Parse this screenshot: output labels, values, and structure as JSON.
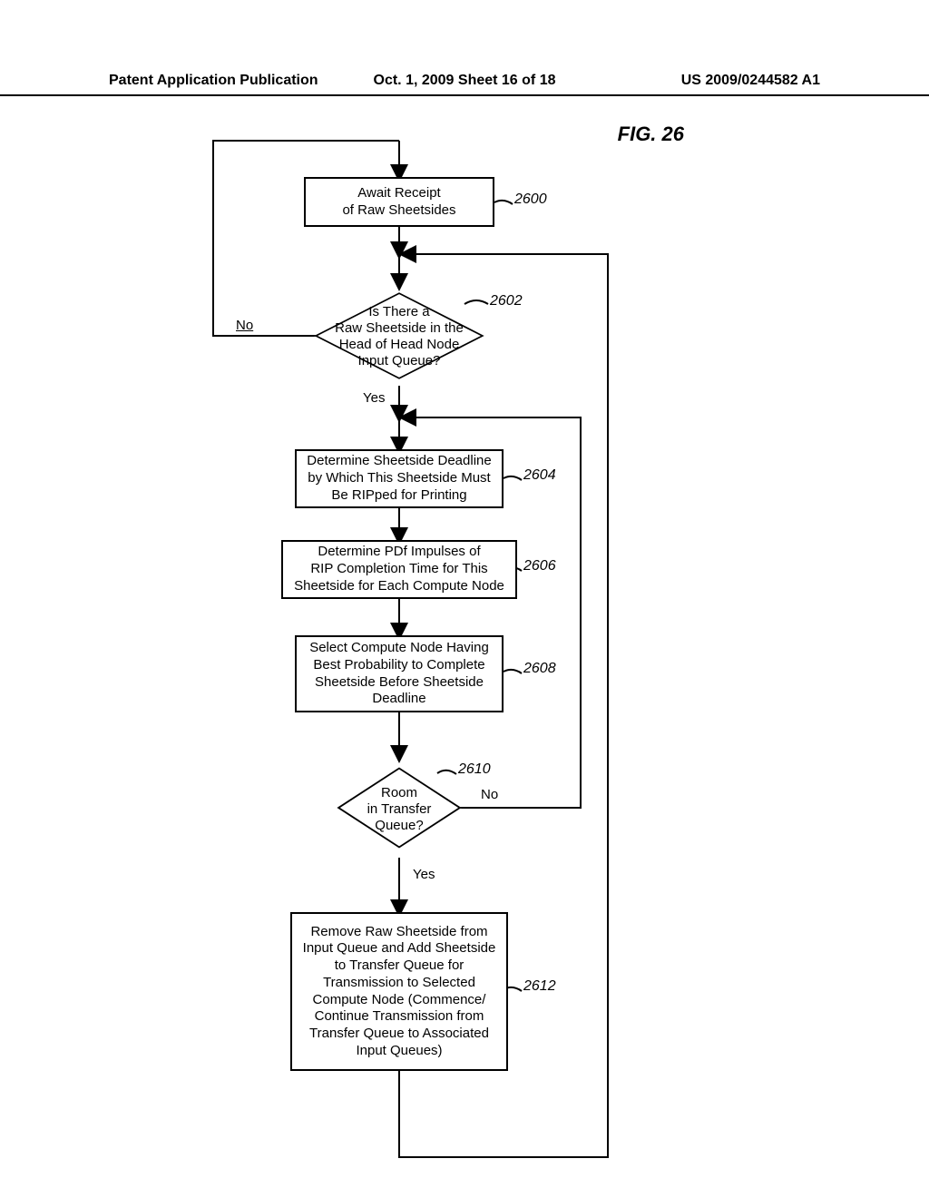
{
  "header": {
    "left": "Patent Application Publication",
    "center": "Oct. 1, 2009   Sheet 16 of 18",
    "right": "US 2009/0244582 A1"
  },
  "figure_label": "FIG. 26",
  "steps": {
    "s2600": "Await Receipt\nof Raw Sheetsides",
    "s2602": "Is There a\nRaw Sheetside in the\nHead of Head Node\nInput Queue?",
    "s2604": "Determine Sheetside Deadline\nby Which This Sheetside Must\nBe RIPped for Printing",
    "s2606": "Determine PDf Impulses of\nRIP Completion Time for This\nSheetside for Each Compute Node",
    "s2608": "Select Compute Node Having\nBest Probability to Complete\nSheetside Before Sheetside\nDeadline",
    "s2610": "Room\nin Transfer\nQueue?",
    "s2612": "Remove Raw Sheetside from\nInput Queue and Add Sheetside\nto Transfer Queue for\nTransmission to Selected\nCompute Node (Commence/\nContinue Transmission from\nTransfer Queue to Associated\nInput Queues)"
  },
  "refs": {
    "r2600": "2600",
    "r2602": "2602",
    "r2604": "2604",
    "r2606": "2606",
    "r2608": "2608",
    "r2610": "2610",
    "r2612": "2612"
  },
  "labels": {
    "no1": "No",
    "yes1": "Yes",
    "no2": "No",
    "yes2": "Yes"
  }
}
